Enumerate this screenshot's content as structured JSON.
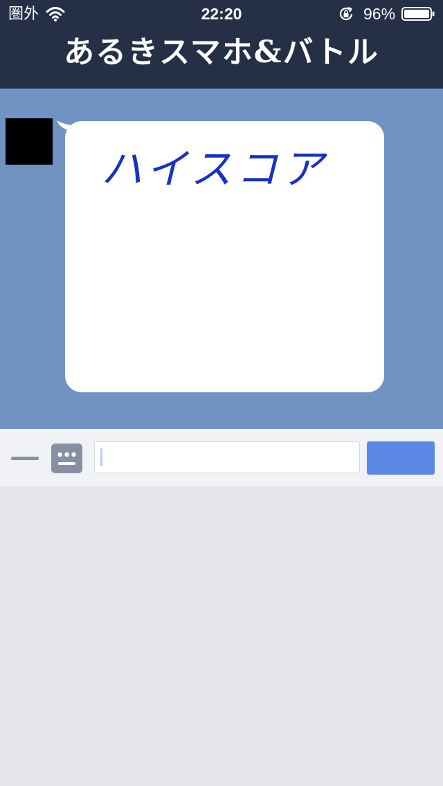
{
  "status_bar": {
    "carrier": "圏外",
    "time": "22:20",
    "battery_percent": "96%",
    "icons": [
      "wifi-icon",
      "orientation-lock-icon",
      "battery-icon"
    ]
  },
  "header": {
    "title": "あるきスマホ&バトル"
  },
  "chat": {
    "messages": [
      {
        "sender_avatar": "avatar-black-square",
        "text": "ハイスコア"
      }
    ]
  },
  "input_bar": {
    "message_value": "",
    "icons": [
      "menu-icon",
      "keyboard-icon"
    ]
  },
  "colors": {
    "header_bg": "#253047",
    "chat_bg": "#7193c3",
    "bubble_bg": "#ffffff",
    "bubble_text": "#1731c6",
    "input_bar_bg": "#f1f2f6",
    "icon_gray": "#878fa3",
    "send_button": "#5b88e4",
    "keyboard_area_bg": "#e6e7ec"
  }
}
